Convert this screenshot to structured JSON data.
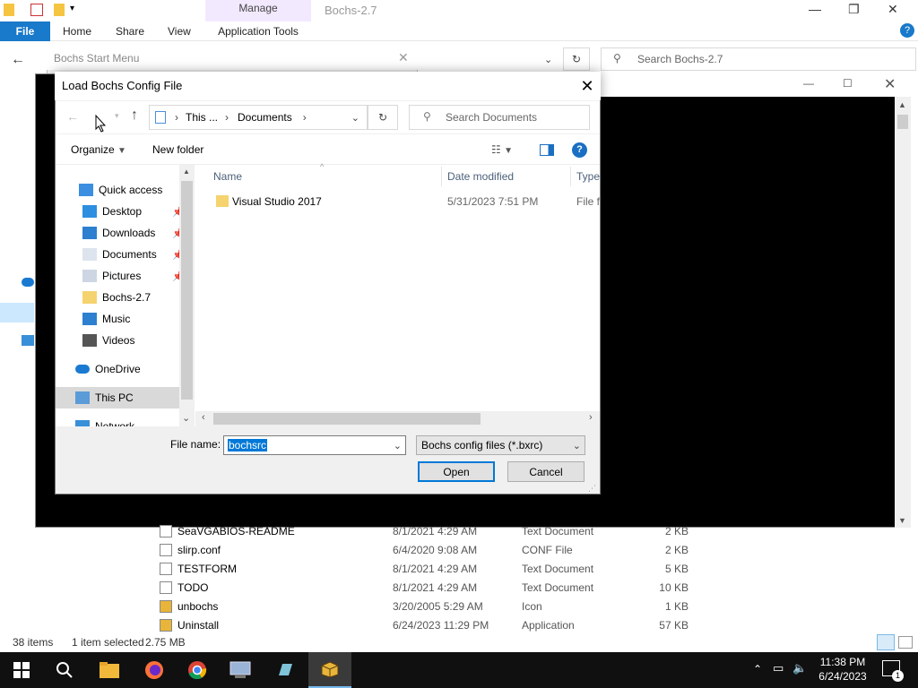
{
  "explorer": {
    "ribbon_tabs": [
      "File",
      "Home",
      "Share",
      "View"
    ],
    "context_tab_group": "Manage",
    "context_tab": "Application Tools",
    "title": "Bochs-2.7",
    "search_placeholder": "Search Bochs-2.7",
    "files": [
      {
        "name": "SeaVGABIOS-README",
        "date": "8/1/2021 4:29 AM",
        "type": "Text Document",
        "size": "2 KB"
      },
      {
        "name": "slirp.conf",
        "date": "6/4/2020 9:08 AM",
        "type": "CONF File",
        "size": "2 KB"
      },
      {
        "name": "TESTFORM",
        "date": "8/1/2021 4:29 AM",
        "type": "Text Document",
        "size": "5 KB"
      },
      {
        "name": "TODO",
        "date": "8/1/2021 4:29 AM",
        "type": "Text Document",
        "size": "10 KB"
      },
      {
        "name": "unbochs",
        "date": "3/20/2005 5:29 AM",
        "type": "Icon",
        "size": "1 KB"
      },
      {
        "name": "Uninstall",
        "date": "6/24/2023 11:29 PM",
        "type": "Application",
        "size": "57 KB"
      }
    ],
    "status": {
      "items": "38 items",
      "selected": "1 item selected",
      "size": "2.75 MB"
    }
  },
  "start_menu": {
    "title": "Bochs Start Menu"
  },
  "dialog": {
    "title": "Load Bochs Config File",
    "breadcrumb": [
      "This ...",
      "Documents"
    ],
    "search_placeholder": "Search Documents",
    "organize_label": "Organize",
    "new_folder_label": "New folder",
    "nav_items": [
      {
        "label": "Quick access",
        "icon": "star-icon",
        "pinned": false
      },
      {
        "label": "Desktop",
        "icon": "desktop-icon",
        "pinned": true
      },
      {
        "label": "Downloads",
        "icon": "download-icon",
        "pinned": true
      },
      {
        "label": "Documents",
        "icon": "document-icon",
        "pinned": true
      },
      {
        "label": "Pictures",
        "icon": "picture-icon",
        "pinned": true
      },
      {
        "label": "Bochs-2.7",
        "icon": "folder-icon",
        "pinned": false
      },
      {
        "label": "Music",
        "icon": "music-icon",
        "pinned": false
      },
      {
        "label": "Videos",
        "icon": "video-icon",
        "pinned": false
      },
      {
        "label": "OneDrive",
        "icon": "cloud-icon",
        "pinned": false
      },
      {
        "label": "This PC",
        "icon": "computer-icon",
        "pinned": false
      },
      {
        "label": "Network",
        "icon": "network-icon",
        "pinned": false
      }
    ],
    "columns": [
      "Name",
      "Date modified",
      "Type"
    ],
    "rows": [
      {
        "name": "Visual Studio 2017",
        "date": "5/31/2023 7:51 PM",
        "type": "File fo"
      }
    ],
    "file_name_label": "File name:",
    "file_name_value": "bochsrc",
    "file_type_value": "Bochs config files (*.bxrc)",
    "open_label": "Open",
    "cancel_label": "Cancel"
  },
  "taskbar": {
    "time": "11:38 PM",
    "date": "6/24/2023",
    "notification_count": "1"
  },
  "colors": {
    "accent": "#0078d7",
    "file_tab": "#1979ca",
    "manage": "#f3e9ff"
  }
}
